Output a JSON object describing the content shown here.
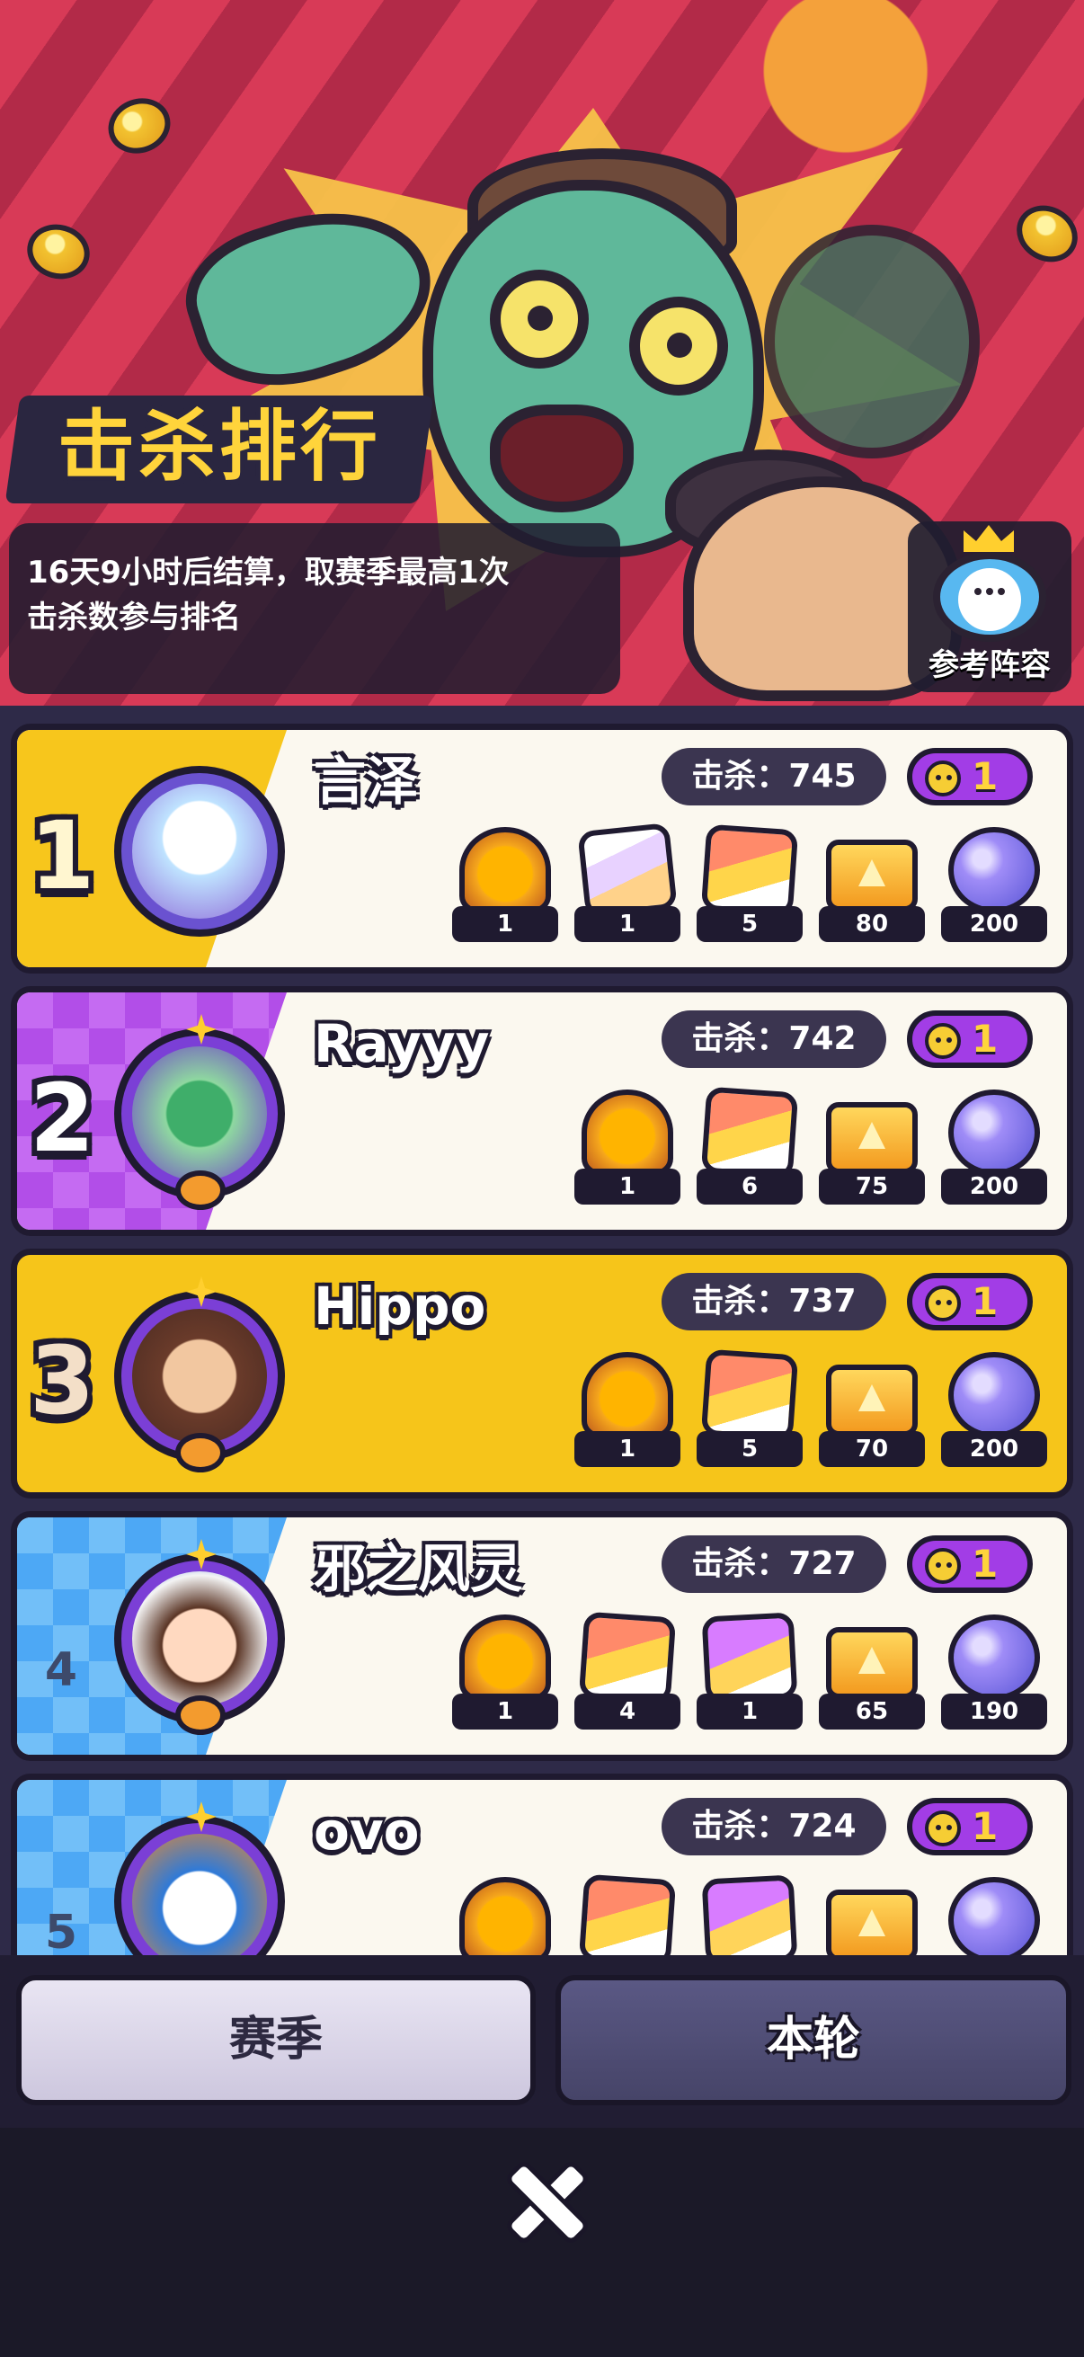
{
  "header": {
    "title": "击杀排行",
    "description": "16天9小时后结算，取赛季最高1次\n击杀数参与排名",
    "lineup_button_label": "参考阵容"
  },
  "ranking": [
    {
      "rank": "1",
      "name": "言泽",
      "kills": "击杀：745",
      "level": "1",
      "rewards": [
        {
          "icon": "avatar-frame-icon",
          "count": "1"
        },
        {
          "icon": "character-card-icon",
          "count": "1"
        },
        {
          "icon": "red-card-pack-icon",
          "count": "5"
        },
        {
          "icon": "gold-ticket-icon",
          "count": "80"
        },
        {
          "icon": "crystal-orb-icon",
          "count": "200"
        }
      ]
    },
    {
      "rank": "2",
      "name": "Rayyy",
      "kills": "击杀：742",
      "level": "1",
      "rewards": [
        {
          "icon": "avatar-frame-icon",
          "count": "1"
        },
        {
          "icon": "red-card-pack-icon",
          "count": "6"
        },
        {
          "icon": "gold-ticket-icon",
          "count": "75"
        },
        {
          "icon": "crystal-orb-icon",
          "count": "200"
        }
      ]
    },
    {
      "rank": "3",
      "name": "Hippo",
      "kills": "击杀：737",
      "level": "1",
      "rewards": [
        {
          "icon": "avatar-frame-icon",
          "count": "1"
        },
        {
          "icon": "red-card-pack-icon",
          "count": "5"
        },
        {
          "icon": "gold-ticket-icon",
          "count": "70"
        },
        {
          "icon": "crystal-orb-icon",
          "count": "200"
        }
      ]
    },
    {
      "rank": "4",
      "name": "邪之风灵",
      "kills": "击杀：727",
      "level": "1",
      "rewards": [
        {
          "icon": "avatar-frame-icon",
          "count": "1"
        },
        {
          "icon": "red-card-pack-icon",
          "count": "4"
        },
        {
          "icon": "purple-card-pack-icon",
          "count": "1"
        },
        {
          "icon": "gold-ticket-icon",
          "count": "65"
        },
        {
          "icon": "crystal-orb-icon",
          "count": "190"
        }
      ]
    },
    {
      "rank": "5",
      "name": "ovo",
      "kills": "击杀：724",
      "level": "1",
      "rewards": [
        {
          "icon": "avatar-frame-icon",
          "count": ""
        },
        {
          "icon": "red-card-pack-icon",
          "count": ""
        },
        {
          "icon": "purple-card-pack-icon",
          "count": ""
        },
        {
          "icon": "gold-ticket-icon",
          "count": ""
        },
        {
          "icon": "crystal-orb-icon",
          "count": ""
        }
      ]
    }
  ],
  "tabs": {
    "season": "赛季",
    "round": "本轮"
  },
  "colors": {
    "gold": "#f6c51a",
    "purple": "#a23de6",
    "blue": "#4da8f5",
    "banner_red": "#d83a57",
    "dark": "#1f1a30"
  }
}
